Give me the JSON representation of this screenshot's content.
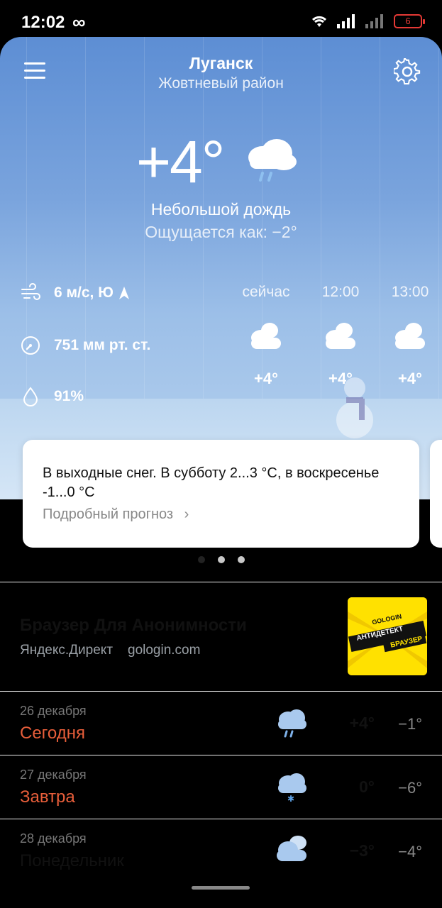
{
  "status_bar": {
    "time": "12:02",
    "battery": "6"
  },
  "header": {
    "city": "Луганск",
    "district": "Жовтневый район"
  },
  "current": {
    "temperature": "+4°",
    "condition": "Небольшой дождь",
    "feels_like": "Ощущается как: −2°",
    "icon": "cloud-rain-icon"
  },
  "details": {
    "wind": "6 м/с, Ю",
    "pressure": "751 мм рт. ст.",
    "humidity": "91%"
  },
  "hourly": [
    {
      "label": "сейчас",
      "temp": "+4°",
      "icon": "cloud-sun-icon"
    },
    {
      "label": "12:00",
      "temp": "+4°",
      "icon": "cloud-sun-icon"
    },
    {
      "label": "13:00",
      "temp": "+4°",
      "icon": "cloud-sun-icon"
    }
  ],
  "card": {
    "text": "В выходные снег. В субботу 2...3 °C, в воскресенье -1...0 °C",
    "link": "Подробный прогноз"
  },
  "ad": {
    "title": "Браузер Для Анонимности",
    "source": "Яндекс.Директ",
    "domain": "gologin.com",
    "image_brand": "GOLOGIN",
    "image_text_1": "АНТИДЕТЕКТ",
    "image_text_2": "БРАУЗЕР"
  },
  "days": [
    {
      "date": "26 декабря",
      "name": "Сегодня",
      "max": "+4°",
      "min": "−1°",
      "icon": "cloud-rain-icon",
      "accent": "#e85e3a"
    },
    {
      "date": "27 декабря",
      "name": "Завтра",
      "max": "0°",
      "min": "−6°",
      "icon": "cloud-snow-icon",
      "accent": "#e85e3a"
    },
    {
      "date": "28 декабря",
      "name": "Понедельник",
      "max": "−3°",
      "min": "−4°",
      "icon": "cloud-icon",
      "accent": "#111111"
    }
  ]
}
